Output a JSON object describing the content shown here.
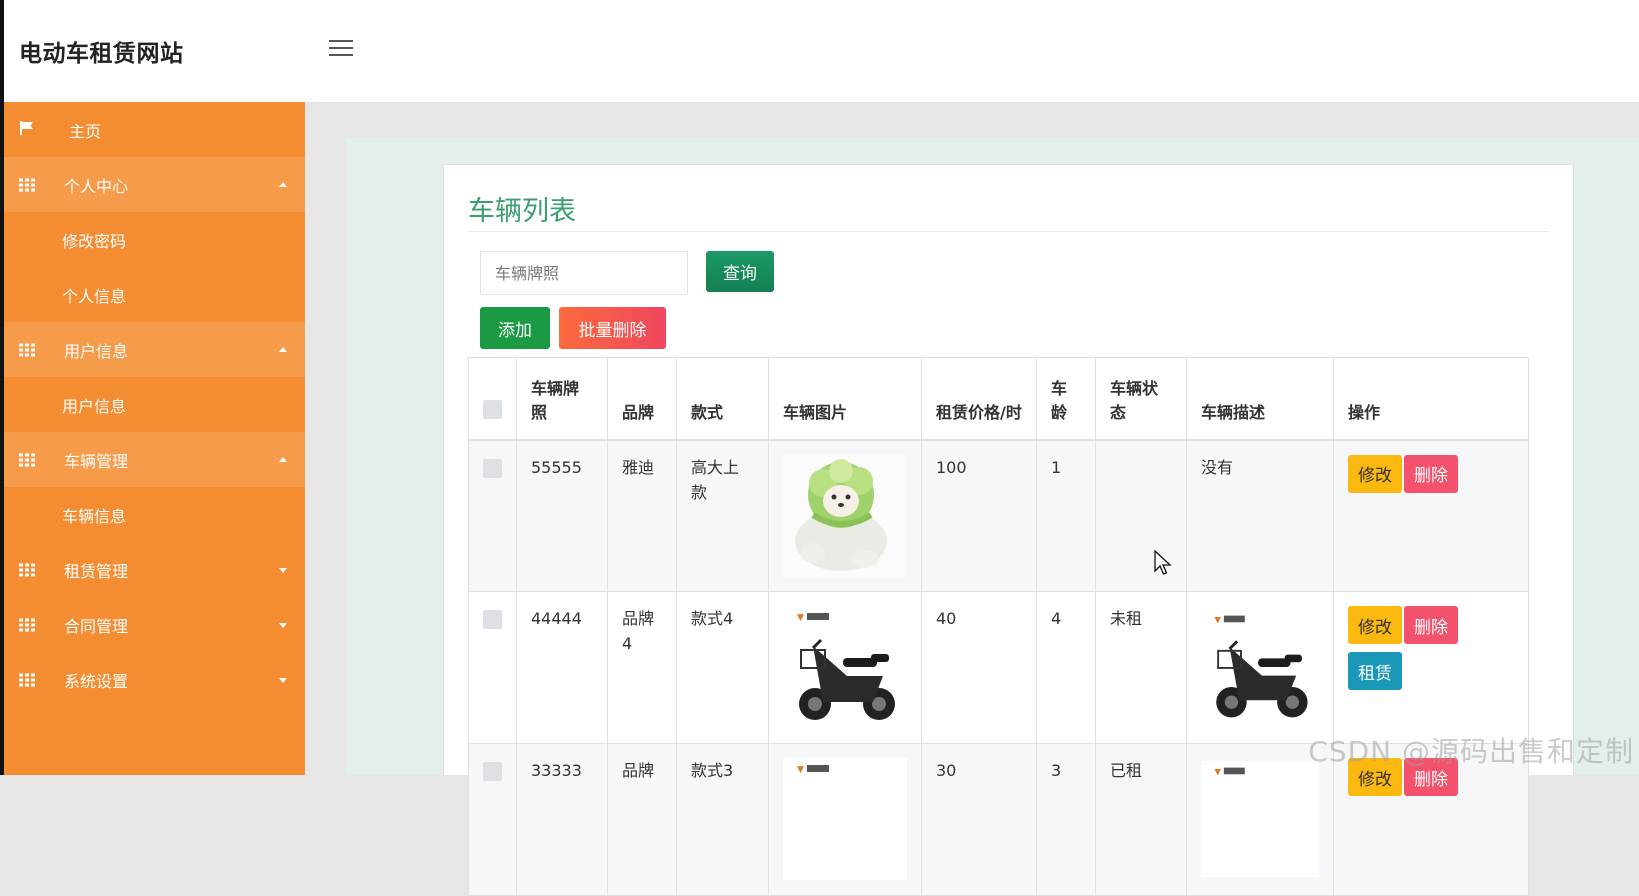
{
  "app": {
    "title": "电动车租赁网站"
  },
  "sidebar": {
    "home": "主页",
    "groups": [
      {
        "label": "个人中心",
        "items": [
          "修改密码",
          "个人信息"
        ]
      },
      {
        "label": "用户信息",
        "items": [
          "用户信息"
        ]
      },
      {
        "label": "车辆管理",
        "items": [
          "车辆信息"
        ]
      },
      {
        "label": "租赁管理",
        "items": []
      },
      {
        "label": "合同管理",
        "items": []
      },
      {
        "label": "系统设置",
        "items": []
      }
    ]
  },
  "main": {
    "title": "车辆列表",
    "search": {
      "placeholder": "车辆牌照",
      "query_label": "查询"
    },
    "buttons": {
      "add": "添加",
      "batch_delete": "批量删除"
    },
    "table": {
      "headers": [
        "车辆牌照",
        "品牌",
        "款式",
        "车辆图片",
        "租赁价格/时",
        "车龄",
        "车辆状态",
        "车辆描述",
        "操作"
      ],
      "rows": [
        {
          "plate": "55555",
          "brand": "雅迪",
          "style": "高大上款",
          "image": "cabbage-dog-picture",
          "price": "100",
          "age": "1",
          "status": "",
          "desc": "没有",
          "desc_image": "",
          "actions": [
            "修改",
            "删除"
          ]
        },
        {
          "plate": "44444",
          "brand": "品牌4",
          "style": "款式4",
          "image": "e-scooter-picture",
          "price": "40",
          "age": "4",
          "status": "未租",
          "desc": "",
          "desc_image": "e-scooter-picture",
          "actions": [
            "修改",
            "删除",
            "租赁"
          ]
        },
        {
          "plate": "33333",
          "brand": "品牌",
          "style": "款式3",
          "image": "e-scooter-picture",
          "price": "30",
          "age": "3",
          "status": "已租",
          "desc": "",
          "desc_image": "e-scooter-picture",
          "actions": [
            "修改",
            "删除"
          ]
        }
      ]
    }
  },
  "watermark": "CSDN @源码出售和定制",
  "colors": {
    "sidebar": "#f48c31",
    "title": "#3a9e6e",
    "edit": "#fbb80f",
    "delete": "#f4516c",
    "rent": "#1a98b8",
    "add": "#199a43"
  },
  "icons": {
    "home": "flag-icon",
    "group": "grid-icon",
    "toggle": "hamburger-icon"
  }
}
